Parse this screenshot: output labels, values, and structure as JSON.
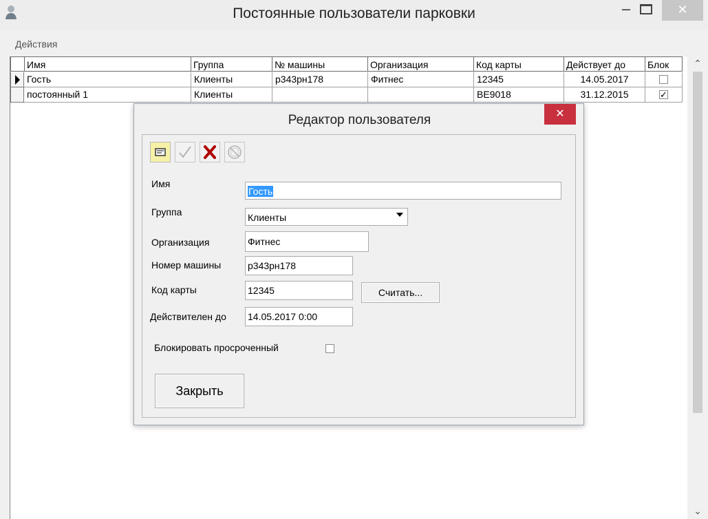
{
  "window": {
    "title": "Постоянные пользователи парковки",
    "minimize": "–",
    "close": "✕"
  },
  "menu": {
    "actions": "Действия"
  },
  "grid": {
    "columns": [
      "Имя",
      "Группа",
      "№ машины",
      "Организация",
      "Код карты",
      "Действует до",
      "Блок"
    ],
    "rows": [
      {
        "name": "Гость",
        "group": "Клиенты",
        "car": "р343рн178",
        "org": "Фитнес",
        "card": "12345",
        "valid": "14.05.2017",
        "blocked": false,
        "current": true
      },
      {
        "name": "постоянный 1",
        "group": "Клиенты",
        "car": "",
        "org": "",
        "card": "BE9018",
        "valid": "31.12.2015",
        "blocked": true,
        "current": false
      }
    ]
  },
  "scrollbar": {
    "up": "⌃",
    "down": "⌄"
  },
  "dialog": {
    "title": "Редактор пользователя",
    "close": "✕",
    "toolbar": {
      "edit_icon": "edit-card-icon",
      "save_icon": "checkmark-icon",
      "delete_icon": "red-x-icon",
      "cancel_icon": "cancel-circle-icon"
    },
    "fields": {
      "name_label": "Имя",
      "name_value": "Гость",
      "group_label": "Группа",
      "group_value": "Клиенты",
      "org_label": "Организация",
      "org_value": "Фитнес",
      "car_label": "Номер машины",
      "car_value": "р343рн178",
      "card_label": "Код карты",
      "card_value": "12345",
      "read_button": "Считать...",
      "valid_label": "Действителен до",
      "valid_value": "14.05.2017 0:00",
      "block_label": "Блокировать просроченный",
      "block_checked": false
    },
    "close_button": "Закрыть"
  }
}
